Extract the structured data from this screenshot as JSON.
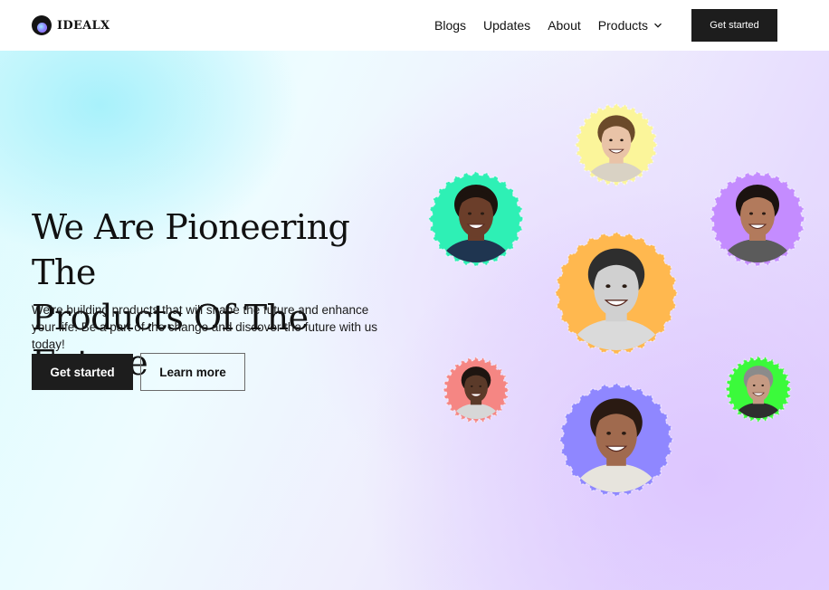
{
  "header": {
    "logo_text": "IDEALX",
    "nav": {
      "blogs": "Blogs",
      "updates": "Updates",
      "about": "About",
      "products": "Products"
    },
    "cta_label": "Get started"
  },
  "hero": {
    "headline_line1": "We Are Pioneering The",
    "headline_line2": "Products Of The Future",
    "subtext": "We're building products that will shape the future and enhance your life. Be a part of the change and discover the future with us today!",
    "primary_label": "Get started",
    "secondary_label": "Learn more"
  },
  "avatars": [
    {
      "name": "avatar-curly-hair-man",
      "bg": "#fbf59a",
      "skin": "#e9c3a7",
      "hair": "#6b4a2a",
      "shirt": "#d9d2c4"
    },
    {
      "name": "avatar-smiling-woman-teal",
      "bg": "#2ef0b5",
      "skin": "#6b3e2a",
      "hair": "#1c130e",
      "shirt": "#1f3550"
    },
    {
      "name": "avatar-laughing-woman-purple",
      "bg": "#c48cff",
      "skin": "#b27a5c",
      "hair": "#1b1310",
      "shirt": "#5b5b5b"
    },
    {
      "name": "avatar-man-orange",
      "bg": "#ffb84f",
      "skin": "#d0d0d0",
      "hair": "#2e2e2e",
      "shirt": "#dadada"
    },
    {
      "name": "avatar-bearded-man-coral",
      "bg": "#f58683",
      "skin": "#5b3a29",
      "hair": "#1e1510",
      "shirt": "#d7d7d7"
    },
    {
      "name": "avatar-man-green",
      "bg": "#3bfa3b",
      "skin": "#c59a83",
      "hair": "#8b8b8b",
      "shirt": "#2e2e2e"
    },
    {
      "name": "avatar-laughing-woman-blue",
      "bg": "#8f87ff",
      "skin": "#a06a4e",
      "hair": "#2a1a12",
      "shirt": "#e7e4dd"
    }
  ]
}
